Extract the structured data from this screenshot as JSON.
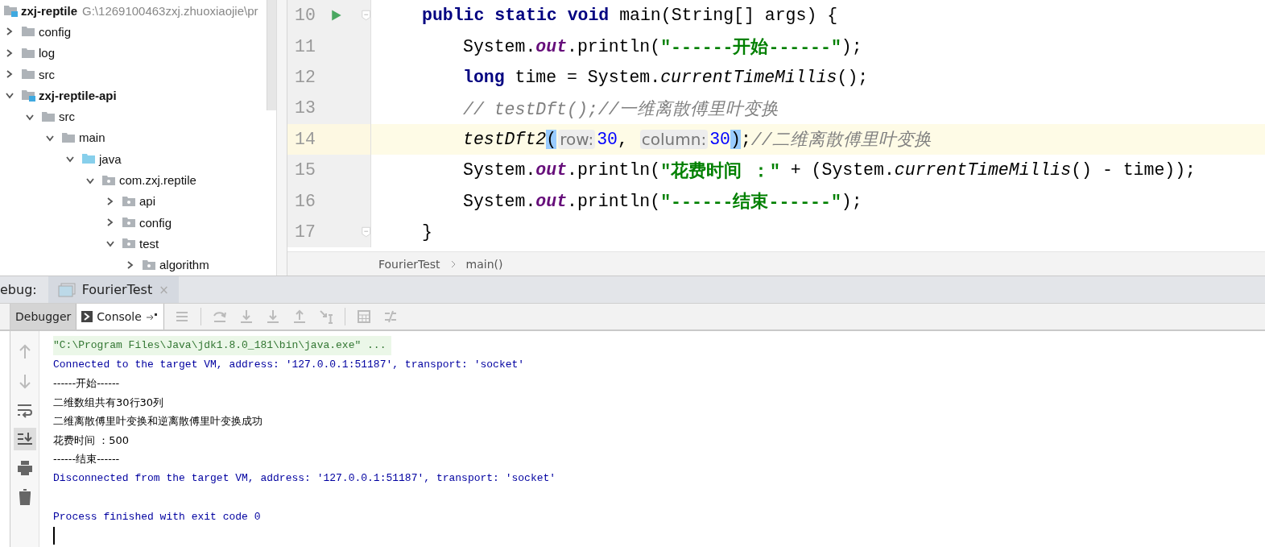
{
  "project_tree": {
    "root": {
      "name": "zxj-reptile",
      "path": "G:\\1269100463zxj.zhuoxiaojie\\pr",
      "kind": "module"
    },
    "items": [
      {
        "name": "config",
        "kind": "folder",
        "expanded": false
      },
      {
        "name": "log",
        "kind": "folder",
        "expanded": false
      },
      {
        "name": "src",
        "kind": "folder",
        "expanded": false
      },
      {
        "name": "zxj-reptile-api",
        "kind": "module",
        "expanded": true,
        "children": [
          {
            "name": "src",
            "kind": "folder",
            "expanded": true,
            "children": [
              {
                "name": "main",
                "kind": "folder",
                "expanded": true,
                "children": [
                  {
                    "name": "java",
                    "kind": "source",
                    "expanded": true,
                    "children": [
                      {
                        "name": "com.zxj.reptile",
                        "kind": "package",
                        "expanded": true,
                        "children": [
                          {
                            "name": "api",
                            "kind": "package",
                            "expanded": false
                          },
                          {
                            "name": "config",
                            "kind": "package",
                            "expanded": false
                          },
                          {
                            "name": "test",
                            "kind": "package",
                            "expanded": true,
                            "children": [
                              {
                                "name": "algorithm",
                                "kind": "package",
                                "expanded": false
                              }
                            ]
                          }
                        ]
                      }
                    ]
                  }
                ]
              }
            ]
          }
        ]
      }
    ]
  },
  "editor": {
    "lines": [
      {
        "number": "10",
        "current": false,
        "runnable": true,
        "tokens": [
          {
            "kind": "keyword",
            "text": "public static void"
          },
          {
            "kind": "plain",
            "text": " main(String[] args) {"
          }
        ],
        "children": [
          {
            "number": "11",
            "current": false,
            "tokens": [
              {
                "kind": "plain",
                "text": "System."
              },
              {
                "kind": "field",
                "text": "out"
              },
              {
                "kind": "plain",
                "text": ".println("
              },
              {
                "kind": "string",
                "text": "\"------开始------\""
              },
              {
                "kind": "plain",
                "text": ");"
              }
            ]
          },
          {
            "number": "12",
            "current": false,
            "tokens": [
              {
                "kind": "keyword",
                "text": "long"
              },
              {
                "kind": "plain",
                "text": " time = System."
              },
              {
                "kind": "static",
                "text": "currentTimeMillis"
              },
              {
                "kind": "plain",
                "text": "();"
              }
            ]
          },
          {
            "number": "13",
            "current": false,
            "tokens": [
              {
                "kind": "comment",
                "text": "// testDft();//一维离散傅里叶变换"
              }
            ]
          },
          {
            "number": "14",
            "current": true,
            "tokens": [
              {
                "kind": "static",
                "text": "testDft2"
              },
              {
                "kind": "match",
                "text": "("
              },
              {
                "kind": "hint",
                "text": "row:"
              },
              {
                "kind": "number",
                "text": "30"
              },
              {
                "kind": "plain",
                "text": ", "
              },
              {
                "kind": "hint",
                "text": "column:"
              },
              {
                "kind": "number",
                "text": "30"
              },
              {
                "kind": "match",
                "text": ")"
              },
              {
                "kind": "plain",
                "text": ";"
              },
              {
                "kind": "comment",
                "text": "//二维离散傅里叶变换"
              }
            ]
          },
          {
            "number": "15",
            "current": false,
            "tokens": [
              {
                "kind": "plain",
                "text": "System."
              },
              {
                "kind": "field",
                "text": "out"
              },
              {
                "kind": "plain",
                "text": ".println("
              },
              {
                "kind": "string",
                "text": "\"花费时间 ：\""
              },
              {
                "kind": "plain",
                "text": " + (System."
              },
              {
                "kind": "static",
                "text": "currentTimeMillis"
              },
              {
                "kind": "plain",
                "text": "() - time));"
              }
            ]
          },
          {
            "number": "16",
            "current": false,
            "tokens": [
              {
                "kind": "plain",
                "text": "System."
              },
              {
                "kind": "field",
                "text": "out"
              },
              {
                "kind": "plain",
                "text": ".println("
              },
              {
                "kind": "string",
                "text": "\"------结束------\""
              },
              {
                "kind": "plain",
                "text": ");"
              }
            ]
          }
        ]
      },
      {
        "number": "17",
        "current": false,
        "tokens": [
          {
            "kind": "plain",
            "text": "}"
          }
        ]
      }
    ],
    "breadcrumb": [
      "FourierTest",
      "main()"
    ]
  },
  "debug": {
    "label": "ebug:",
    "tab": "FourierTest",
    "tab_close": "×",
    "subtabs": [
      {
        "label": "Debugger",
        "selected": false
      },
      {
        "label": "Console",
        "selected": true
      }
    ],
    "console": [
      {
        "kind": "command",
        "text": "\"C:\\Program Files\\Java\\jdk1.8.0_181\\bin\\java.exe\" ..."
      },
      {
        "kind": "system",
        "text": "Connected to the target VM, address: '127.0.0.1:51187', transport: 'socket'"
      },
      {
        "kind": "output",
        "text": "------开始------"
      },
      {
        "kind": "output",
        "text": "二维数组共有30行30列"
      },
      {
        "kind": "output",
        "text": "二维离散傅里叶变换和逆离散傅里叶变换成功"
      },
      {
        "kind": "output",
        "text": "花费时间 ：500"
      },
      {
        "kind": "output",
        "text": "------结束------"
      },
      {
        "kind": "system",
        "text": "Disconnected from the target VM, address: '127.0.0.1:51187', transport: 'socket'"
      },
      {
        "kind": "blank"
      },
      {
        "kind": "system",
        "text": "Process finished with exit code 0"
      }
    ]
  }
}
